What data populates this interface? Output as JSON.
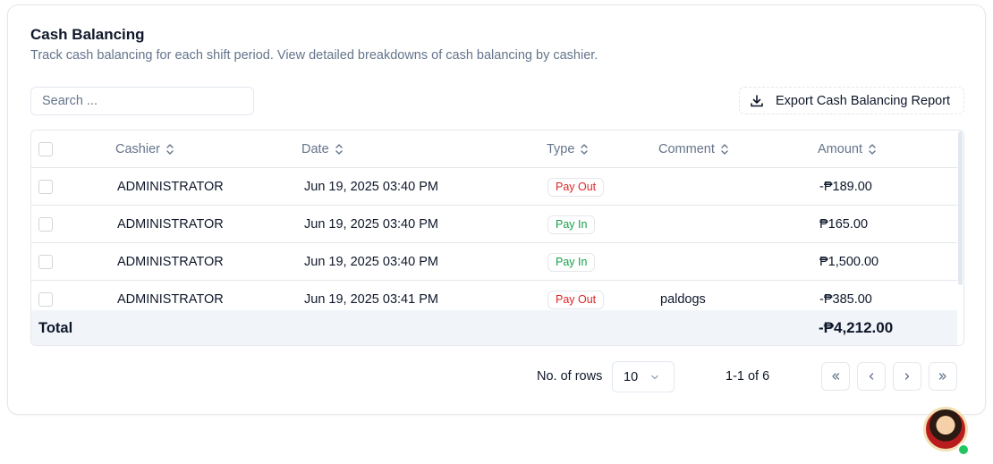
{
  "header": {
    "title": "Cash Balancing",
    "subtitle": "Track cash balancing for each shift period. View detailed breakdowns of cash balancing by cashier."
  },
  "search": {
    "placeholder": "Search ...",
    "value": ""
  },
  "export": {
    "label": "Export Cash Balancing Report",
    "icon": "download-icon"
  },
  "table": {
    "columns": [
      "Cashier",
      "Date",
      "Type",
      "Comment",
      "Amount"
    ],
    "rows": [
      {
        "cashier": "ADMINISTRATOR",
        "date": "Jun 19, 2025 03:40 PM",
        "type": "Pay Out",
        "comment": "",
        "amount": "-₱189.00"
      },
      {
        "cashier": "ADMINISTRATOR",
        "date": "Jun 19, 2025 03:40 PM",
        "type": "Pay In",
        "comment": "",
        "amount": "₱165.00"
      },
      {
        "cashier": "ADMINISTRATOR",
        "date": "Jun 19, 2025 03:40 PM",
        "type": "Pay In",
        "comment": "",
        "amount": "₱1,500.00"
      },
      {
        "cashier": "ADMINISTRATOR",
        "date": "Jun 19, 2025 03:41 PM",
        "type": "Pay Out",
        "comment": "paldogs",
        "amount": "-₱385.00"
      }
    ],
    "total_label": "Total",
    "total_value": "-₱4,212.00"
  },
  "pagination": {
    "rows_label": "No. of rows",
    "rows_value": "10",
    "range": "1-1 of 6"
  },
  "colors": {
    "pay_out": "#dc2626",
    "pay_in": "#16a34a",
    "online_status": "#22c55e"
  }
}
